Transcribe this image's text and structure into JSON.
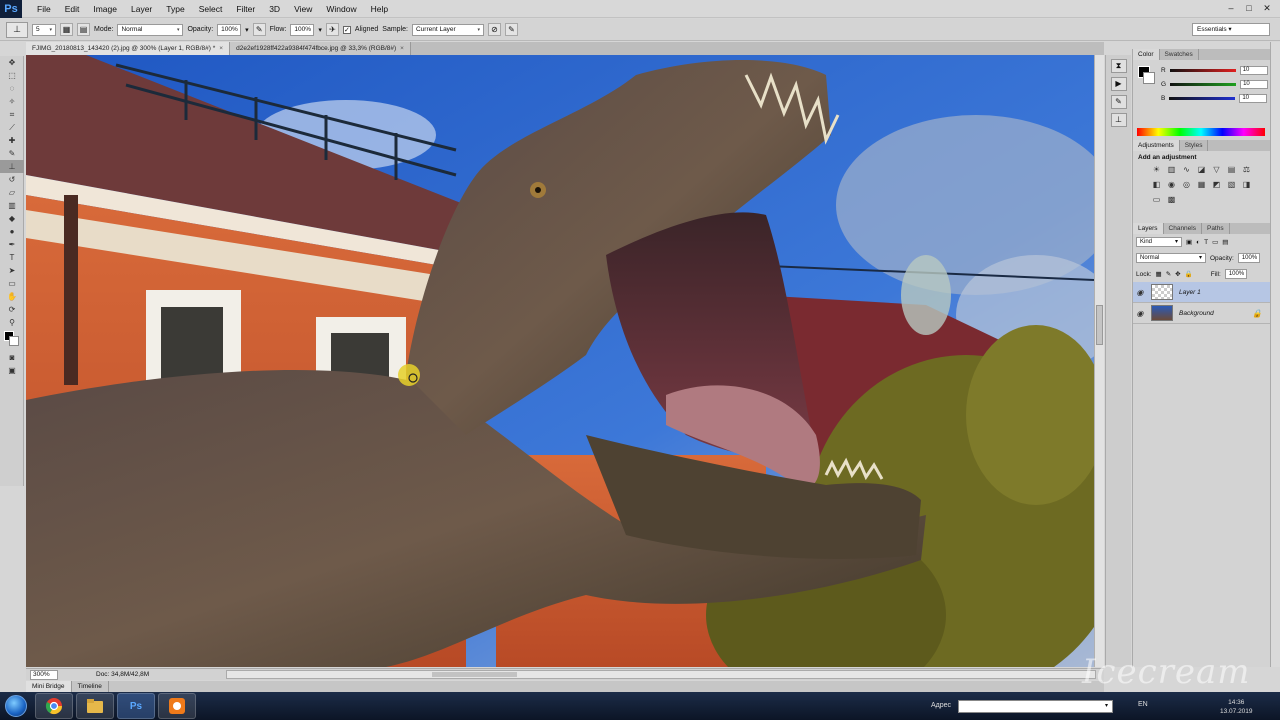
{
  "app": {
    "logo": "Ps"
  },
  "menu": [
    "File",
    "Edit",
    "Image",
    "Layer",
    "Type",
    "Select",
    "Filter",
    "3D",
    "View",
    "Window",
    "Help"
  ],
  "window_controls": {
    "minimize": "–",
    "maximize": "□",
    "close": "✕"
  },
  "options_bar": {
    "brush_size": "5",
    "mode_label": "Mode:",
    "mode_value": "Normal",
    "opacity_label": "Opacity:",
    "opacity_value": "100%",
    "flow_label": "Flow:",
    "flow_value": "100%",
    "aligned_label": "Aligned",
    "sample_label": "Sample:",
    "sample_value": "Current Layer"
  },
  "workspace": "Essentials",
  "doc_tabs": [
    {
      "label": "FJIMG_20180813_143420 (2).jpg @ 300% (Layer 1, RGB/8#) *"
    },
    {
      "label": "d2e2ef1928ff422a9384f474fbce.jpg @ 33,3% (RGB/8#)"
    }
  ],
  "status": {
    "zoom": "300%",
    "doc": "Doc: 34,8M/42,8M"
  },
  "bottom_tabs": [
    "Mini Bridge",
    "Timeline"
  ],
  "color_panel": {
    "tabs": [
      "Color",
      "Swatches"
    ],
    "r_label": "R",
    "g_label": "G",
    "b_label": "B",
    "r": "10",
    "g": "10",
    "b": "10",
    "colors": {
      "r": "#e02020",
      "g": "#20a020",
      "b": "#2030d0"
    }
  },
  "adjustments_panel": {
    "tabs": [
      "Adjustments",
      "Styles"
    ],
    "title": "Add an adjustment"
  },
  "layers_panel": {
    "tabs": [
      "Layers",
      "Channels",
      "Paths"
    ],
    "kind": "Kind",
    "blend_mode": "Normal",
    "opacity_label": "Opacity:",
    "opacity_value": "100%",
    "lock_label": "Lock:",
    "fill_label": "Fill:",
    "fill_value": "100%",
    "layers": [
      {
        "name": "Layer 1"
      },
      {
        "name": "Background"
      }
    ]
  },
  "taskbar": {
    "address_label": "Адрес",
    "lang": "EN",
    "time": "14:36",
    "date": "13.07.2019",
    "apps": [
      "chrome-icon",
      "explorer-icon",
      "photoshop-icon",
      "recorder-icon"
    ]
  },
  "watermark": "Icecream"
}
